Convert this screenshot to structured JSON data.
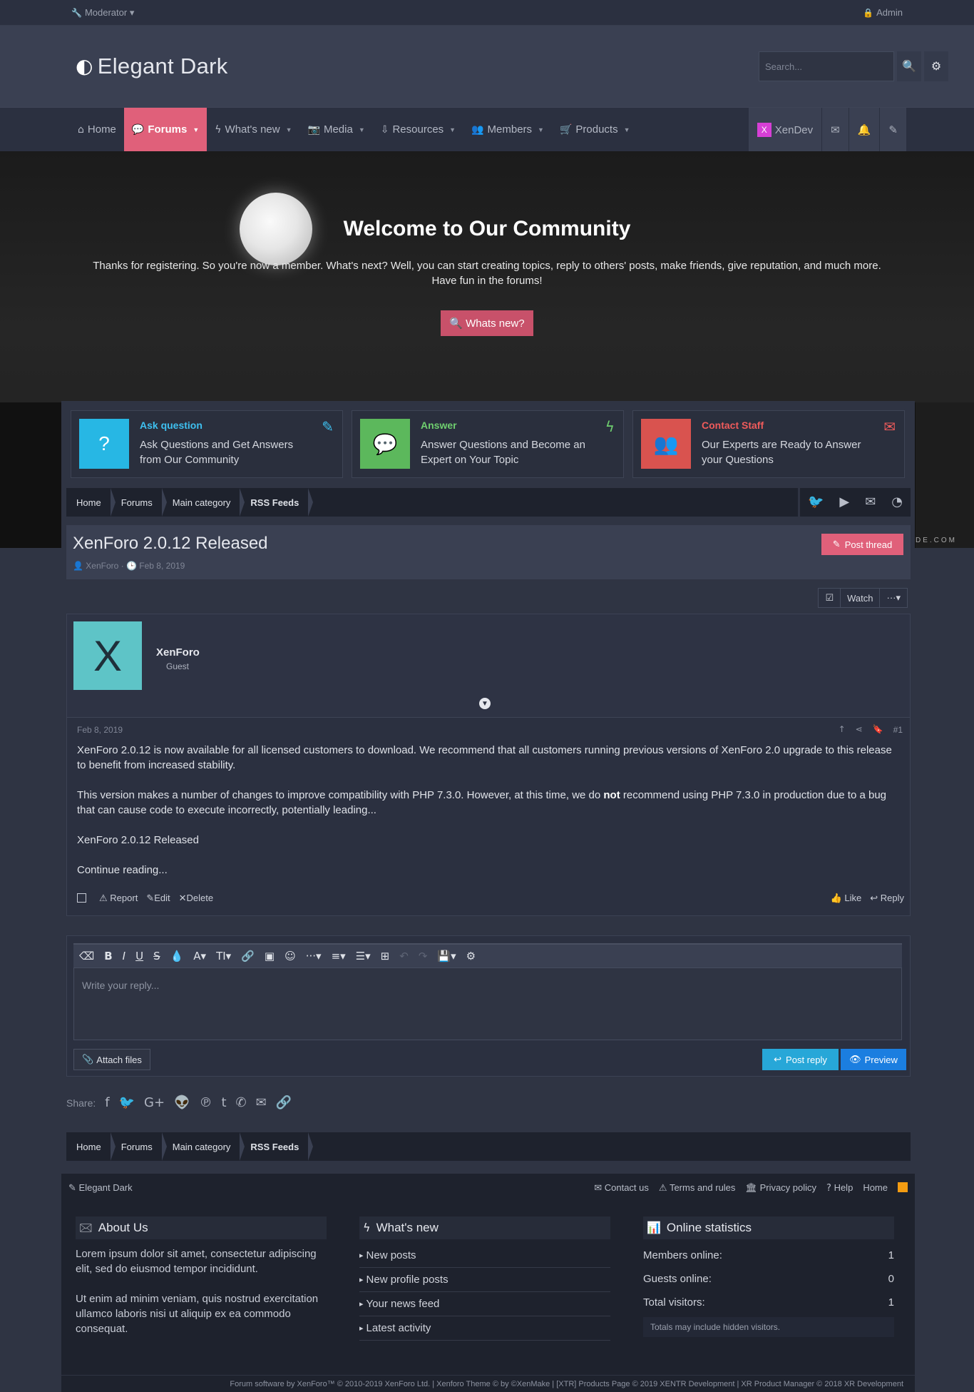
{
  "topbar": {
    "left": "Moderator ▾",
    "right": "Admin"
  },
  "header": {
    "logo": "Elegant Dark",
    "search_placeholder": "Search..."
  },
  "nav": {
    "items": [
      {
        "label": "Home"
      },
      {
        "label": "Forums"
      },
      {
        "label": "What's new"
      },
      {
        "label": "Media"
      },
      {
        "label": "Resources"
      },
      {
        "label": "Members"
      },
      {
        "label": "Products"
      }
    ],
    "user": "XenDev",
    "user_badge": "X"
  },
  "hero": {
    "title": "Welcome to Our Community",
    "lead_1": "Thanks for registering. So you're now a member. What's next? Well, you can start creating topics, reply to others' posts, make friends, give reputation, and much more.",
    "lead_2": "Have fun in the forums!",
    "button": "Whats new?",
    "watermark": "DE.COM"
  },
  "cards": [
    {
      "title": "Ask question",
      "desc": "Ask Questions and Get Answers from Our Community",
      "color": "#27b7e4",
      "title_color": "#3ec0f0"
    },
    {
      "title": "Answer",
      "desc": "Answer Questions and Become an Expert on Your Topic",
      "color": "#5cb85c",
      "title_color": "#6fcf6f"
    },
    {
      "title": "Contact Staff",
      "desc": "Our Experts are Ready to Answer your Questions",
      "color": "#d9534f",
      "title_color": "#ef5b5b"
    }
  ],
  "breadcrumb": [
    "Home",
    "Forums",
    "Main category",
    "RSS Feeds"
  ],
  "thread": {
    "title": "XenForo 2.0.12 Released",
    "author": "XenForo",
    "date": "Feb 8, 2019",
    "post_thread": "Post thread",
    "watch": "Watch",
    "more": "···▾"
  },
  "post": {
    "avatar_letter": "X",
    "username": "XenForo",
    "role": "Guest",
    "date": "Feb 8, 2019",
    "number": "#1",
    "p1": "XenForo 2.0.12 is now available for all licensed customers to download. We recommend that all customers running previous versions of XenForo 2.0 upgrade to this release to benefit from increased stability.",
    "p2_a": "This version makes a number of changes to improve compatibility with PHP 7.3.0. However, at this time, we do ",
    "p2_b": "not",
    "p2_c": " recommend using PHP 7.3.0 in production due to a bug that can cause code to execute incorrectly, potentially leading...",
    "p3": "XenForo 2.0.12 Released",
    "p4": "Continue reading...",
    "report": "Report",
    "edit": "Edit",
    "delete": "Delete",
    "like": "Like",
    "reply": "Reply"
  },
  "editor": {
    "placeholder": "Write your reply...",
    "attach": "Attach files",
    "post_reply": "Post reply",
    "preview": "Preview"
  },
  "share": {
    "label": "Share:"
  },
  "footer": {
    "brand": "Elegant Dark",
    "links": [
      "Contact us",
      "Terms and rules",
      "Privacy policy",
      "Help",
      "Home"
    ],
    "about_title": "About Us",
    "about_1": "Lorem ipsum dolor sit amet, consectetur adipiscing elit, sed do eiusmod tempor incididunt.",
    "about_2": "Ut enim ad minim veniam, quis nostrud exercitation ullamco laboris nisi ut aliquip ex ea commodo consequat.",
    "whatsnew_title": "What's new",
    "whatsnew": [
      "New posts",
      "New profile posts",
      "Your news feed",
      "Latest activity"
    ],
    "stats_title": "Online statistics",
    "stats": [
      {
        "label": "Members online:",
        "value": "1"
      },
      {
        "label": "Guests online:",
        "value": "0"
      },
      {
        "label": "Total visitors:",
        "value": "1"
      }
    ],
    "hidden_note": "Totals may include hidden visitors.",
    "copyright": "Forum software by XenForo™ © 2010-2019 XenForo Ltd. | Xenforo Theme © by ©XenMake | [XTR] Products Page © 2019 XENTR Development | XR Product Manager © 2018 XR Development"
  }
}
